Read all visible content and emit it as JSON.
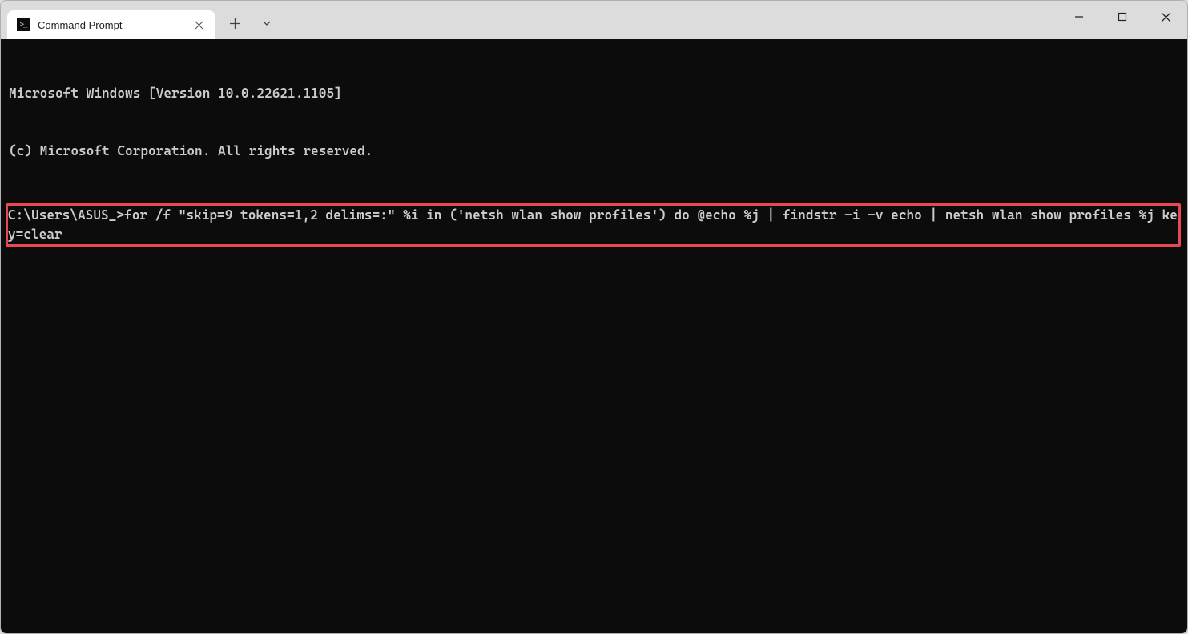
{
  "titlebar": {
    "tabs": [
      {
        "title": "Command Prompt"
      }
    ]
  },
  "terminal": {
    "line1": "Microsoft Windows [Version 10.0.22621.1105]",
    "line2": "(c) Microsoft Corporation. All rights reserved.",
    "prompt": "C:\\Users\\ASUS_>",
    "command": "for /f \"skip=9 tokens=1,2 delims=:\" %i in ('netsh wlan show profiles') do @echo %j | findstr -i -v echo | netsh wlan show profiles %j key=clear"
  }
}
